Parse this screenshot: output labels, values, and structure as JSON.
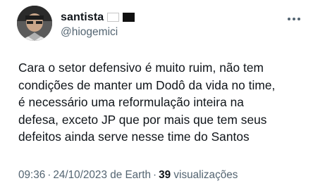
{
  "user": {
    "display_name": "santista",
    "handle": "@hiogemici"
  },
  "tweet": {
    "text": "Cara o setor defensivo é muito ruim, não tem\ncondições de manter um Dodô da vida no time,\né necessário uma reformulação inteira na\ndefesa, exceto JP que por mais que tem seus\ndefeitos ainda serve nesse time do Santos",
    "time": "09:36",
    "date_source": "24/10/2023 de Earth",
    "view_count": "39",
    "view_label": "visualizações"
  },
  "icons": {
    "avatar": "avatar-photo",
    "flag_white": "white-flag-icon",
    "flag_black": "black-flag-icon",
    "menu": "more-options-icon"
  },
  "colors": {
    "text_primary": "#0f1419",
    "text_secondary": "#536471",
    "background": "#ffffff"
  }
}
